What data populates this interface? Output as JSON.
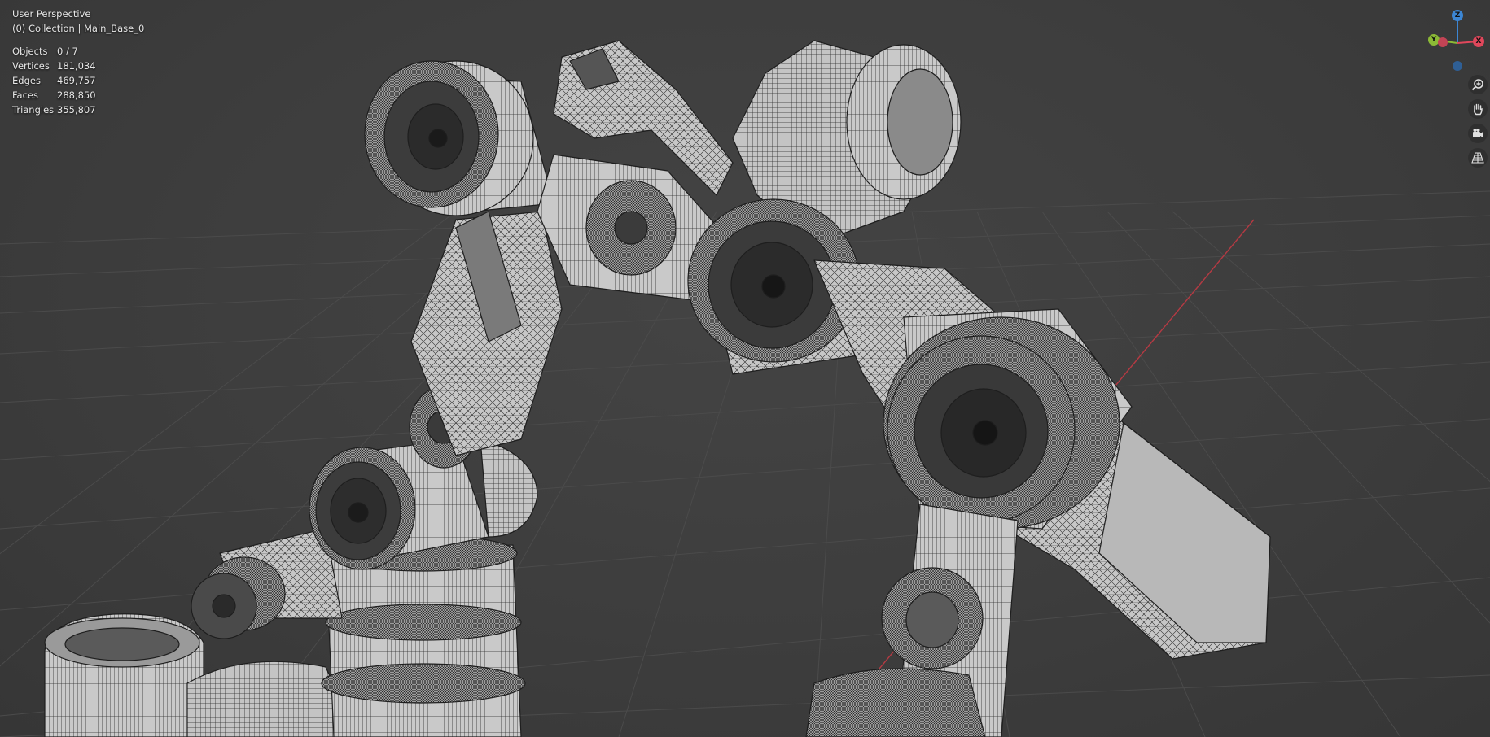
{
  "viewport": {
    "view_mode": "User Perspective",
    "collection_line": "(0) Collection | Main_Base_0"
  },
  "stats": {
    "rows": [
      {
        "label": "Objects",
        "value": "0 / 7"
      },
      {
        "label": "Vertices",
        "value": "181,034"
      },
      {
        "label": "Edges",
        "value": "469,757"
      },
      {
        "label": "Faces",
        "value": "288,850"
      },
      {
        "label": "Triangles",
        "value": "355,807"
      }
    ]
  },
  "gizmo": {
    "z_label": "Z",
    "y_label": "Y",
    "x_label": "X",
    "colors": {
      "x": "#e0475b",
      "y": "#8cba36",
      "z": "#3c86d4"
    }
  },
  "nav_buttons": {
    "icons": [
      "zoom-icon",
      "pan-hand-icon",
      "camera-view-icon",
      "perspective-grid-icon"
    ]
  },
  "theme": {
    "background": "#3d3d3d",
    "grid_line": "#4a4a4a",
    "x_axis": "#b53a43",
    "mesh_fill": "#bfbfbf",
    "wire": "#1e1e1e"
  }
}
